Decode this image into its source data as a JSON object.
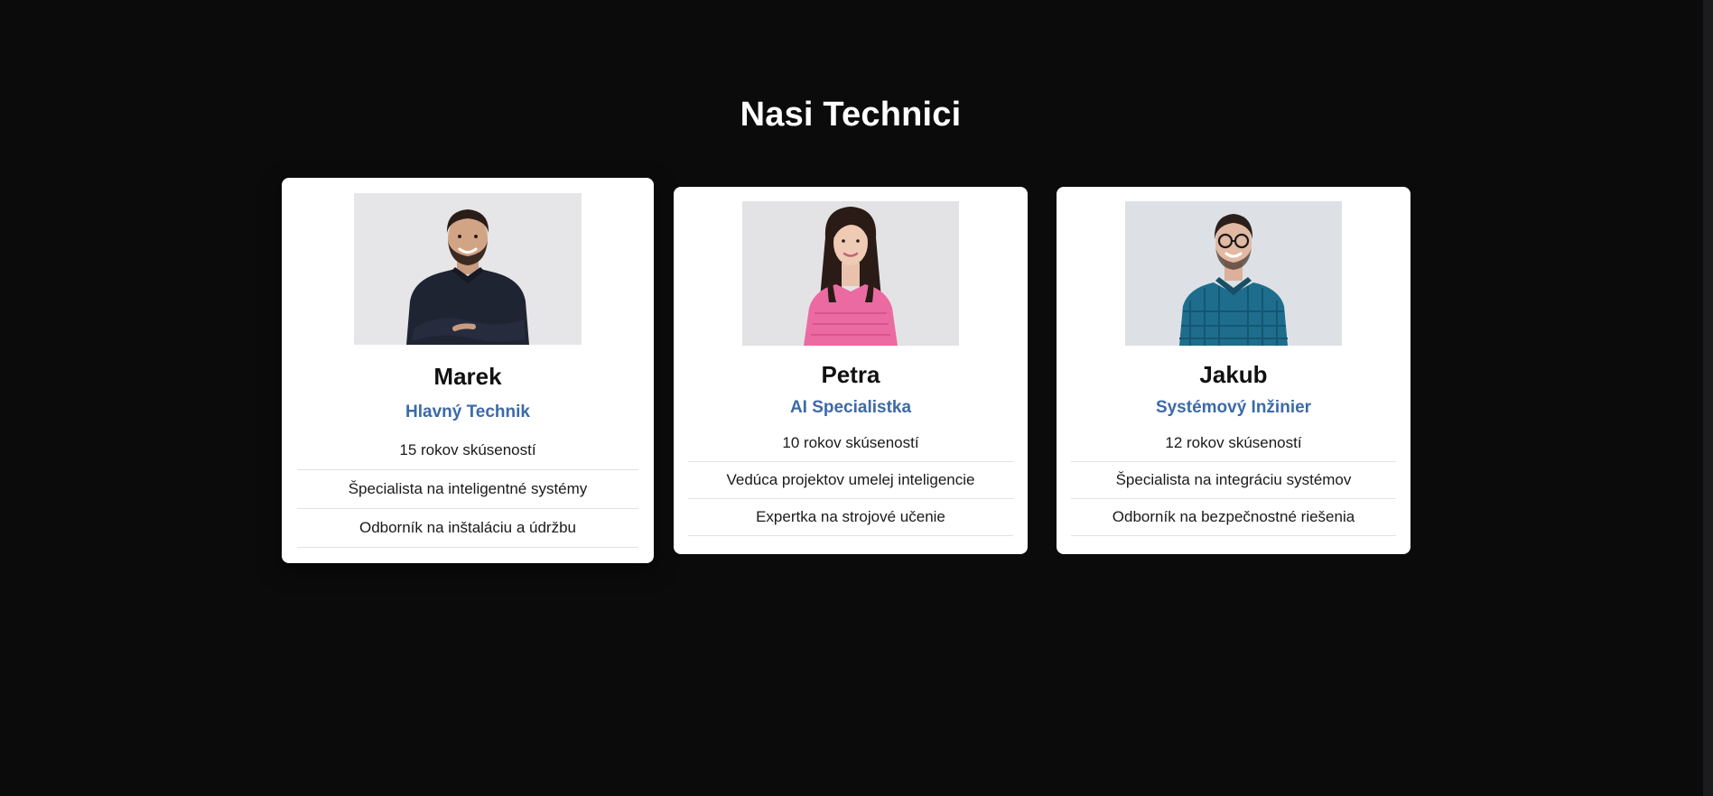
{
  "section": {
    "title": "Nasi Technici"
  },
  "technicians": [
    {
      "name": "Marek",
      "role": "Hlavný Technik",
      "facts": [
        "15 rokov skúseností",
        "Špecialista na inteligentné systémy",
        "Odborník na inštaláciu a údržbu"
      ],
      "photo_icon": "man-crossed-arms-portrait"
    },
    {
      "name": "Petra",
      "role": "AI Specialistka",
      "facts": [
        "10 rokov skúseností",
        "Vedúca projektov umelej inteligencie",
        "Expertka na strojové učenie"
      ],
      "photo_icon": "woman-pink-sweater-portrait"
    },
    {
      "name": "Jakub",
      "role": "Systémový Inžinier",
      "facts": [
        "12 rokov skúseností",
        "Špecialista na integráciu systémov",
        "Odborník na bezpečnostné riešenia"
      ],
      "photo_icon": "man-glasses-plaid-shirt-portrait"
    }
  ],
  "colors": {
    "background": "#0b0b0c",
    "card": "#ffffff",
    "accent": "#3b6aa8",
    "name": "#111111"
  }
}
